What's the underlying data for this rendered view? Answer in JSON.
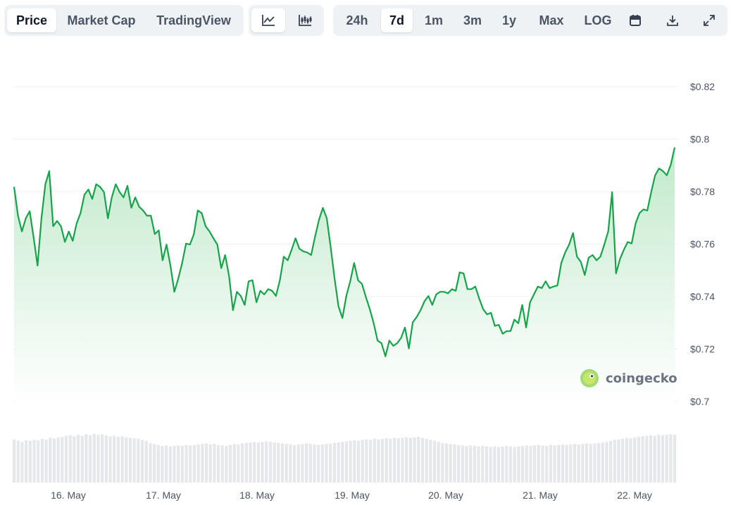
{
  "toolbar": {
    "metric_tabs": [
      "Price",
      "Market Cap",
      "TradingView"
    ],
    "active_metric": "Price",
    "chart_style_icons": [
      "line-chart-icon",
      "candlestick-icon"
    ],
    "ranges": [
      "24h",
      "7d",
      "1m",
      "3m",
      "1y",
      "Max",
      "LOG"
    ],
    "active_range": "7d",
    "action_icons": [
      "calendar-icon",
      "download-icon",
      "expand-icon"
    ]
  },
  "watermark": "coingecko",
  "colors": {
    "line": "#16a34a",
    "area_top": "#bde8c8",
    "volume": "#e5e7eb",
    "grid": "#eef0f3",
    "active_tab_bg": "#ffffff",
    "toolbar_bg": "#eff2f5"
  },
  "chart_data": {
    "type": "area",
    "ylim": [
      0.7,
      0.82
    ],
    "y_ticks": [
      "$0.82",
      "$0.8",
      "$0.78",
      "$0.76",
      "$0.74",
      "$0.72",
      "$0.7"
    ],
    "x_ticks": [
      "16. May",
      "17. May",
      "18. May",
      "19. May",
      "20. May",
      "21. May",
      "22. May"
    ],
    "series": [
      {
        "values": [
          0.7818,
          0.7708,
          0.7648,
          0.7698,
          0.7725,
          0.7625,
          0.7518,
          0.7698,
          0.7828,
          0.7878,
          0.7668,
          0.7688,
          0.7668,
          0.7608,
          0.7648,
          0.7612,
          0.7678,
          0.7718,
          0.7788,
          0.7808,
          0.7772,
          0.7828,
          0.7818,
          0.7798,
          0.7698,
          0.7778,
          0.7828,
          0.7798,
          0.7778,
          0.7822,
          0.7738,
          0.7778,
          0.7742,
          0.7728,
          0.7708,
          0.7708,
          0.7638,
          0.7652,
          0.7538,
          0.7598,
          0.7518,
          0.7418,
          0.7468,
          0.7528,
          0.7602,
          0.7598,
          0.7638,
          0.7728,
          0.7718,
          0.7668,
          0.7648,
          0.7622,
          0.7598,
          0.7508,
          0.7558,
          0.7478,
          0.7348,
          0.7418,
          0.7402,
          0.7368,
          0.7458,
          0.7462,
          0.7378,
          0.7422,
          0.7408,
          0.7428,
          0.7422,
          0.7402,
          0.7462,
          0.7552,
          0.7538,
          0.7578,
          0.7622,
          0.7582,
          0.7572,
          0.7568,
          0.7558,
          0.7628,
          0.7692,
          0.7738,
          0.7698,
          0.7588,
          0.7468,
          0.7362,
          0.7318,
          0.7402,
          0.7458,
          0.7528,
          0.7462,
          0.7448,
          0.7398,
          0.7352,
          0.7298,
          0.7232,
          0.7222,
          0.7172,
          0.7232,
          0.7212,
          0.7222,
          0.7242,
          0.7282,
          0.7202,
          0.7302,
          0.7322,
          0.7348,
          0.7382,
          0.7402,
          0.7368,
          0.7408,
          0.7418,
          0.7418,
          0.7412,
          0.7428,
          0.7422,
          0.7492,
          0.7488,
          0.7428,
          0.7428,
          0.7438,
          0.7392,
          0.7352,
          0.7332,
          0.7338,
          0.7288,
          0.7292,
          0.7258,
          0.7268,
          0.7268,
          0.7312,
          0.7298,
          0.7368,
          0.7282,
          0.7378,
          0.7408,
          0.7438,
          0.7432,
          0.7458,
          0.7432,
          0.7438,
          0.7442,
          0.7528,
          0.7568,
          0.7598,
          0.7642,
          0.7552,
          0.7532,
          0.7482,
          0.7548,
          0.7558,
          0.7538,
          0.7552,
          0.7598,
          0.7648,
          0.7798,
          0.7488,
          0.7542,
          0.7578,
          0.7608,
          0.7602,
          0.7678,
          0.7718,
          0.7732,
          0.7728,
          0.7798,
          0.7862,
          0.7888,
          0.7878,
          0.7862,
          0.7902,
          0.7968
        ]
      }
    ],
    "volume_relative": [
      0.85,
      0.82,
      0.8,
      0.83,
      0.82,
      0.84,
      0.83,
      0.86,
      0.84,
      0.88,
      0.87,
      0.89,
      0.9,
      0.92,
      0.93,
      0.91,
      0.94,
      0.92,
      0.95,
      0.93,
      0.96,
      0.94,
      0.95,
      0.93,
      0.91,
      0.92,
      0.9,
      0.91,
      0.89,
      0.88,
      0.87,
      0.86,
      0.84,
      0.82,
      0.78,
      0.76,
      0.74,
      0.72,
      0.73,
      0.71,
      0.72,
      0.73,
      0.72,
      0.74,
      0.73,
      0.74,
      0.75,
      0.76,
      0.77,
      0.75,
      0.76,
      0.74,
      0.73,
      0.72,
      0.74,
      0.76,
      0.75,
      0.77,
      0.78,
      0.79,
      0.8,
      0.79,
      0.8,
      0.81,
      0.8,
      0.79,
      0.78,
      0.77,
      0.76,
      0.75,
      0.74,
      0.75,
      0.76,
      0.77,
      0.76,
      0.75,
      0.74,
      0.75,
      0.76,
      0.77,
      0.78,
      0.79,
      0.8,
      0.81,
      0.82,
      0.83,
      0.82,
      0.84,
      0.85,
      0.84,
      0.86,
      0.85,
      0.86,
      0.87,
      0.86,
      0.88,
      0.87,
      0.88,
      0.89,
      0.88,
      0.89,
      0.9,
      0.88,
      0.86,
      0.84,
      0.82,
      0.8,
      0.78,
      0.77,
      0.76,
      0.75,
      0.74,
      0.73,
      0.72,
      0.73,
      0.72,
      0.71,
      0.72,
      0.71,
      0.7,
      0.71,
      0.7,
      0.71,
      0.72,
      0.71,
      0.7,
      0.71,
      0.72,
      0.73,
      0.72,
      0.73,
      0.74,
      0.73,
      0.72,
      0.74,
      0.73,
      0.74,
      0.75,
      0.74,
      0.75,
      0.76,
      0.75,
      0.76,
      0.77,
      0.76,
      0.77,
      0.78,
      0.79,
      0.8,
      0.82,
      0.84,
      0.85,
      0.86,
      0.88,
      0.87,
      0.89,
      0.9,
      0.91,
      0.92,
      0.93,
      0.92,
      0.94,
      0.93,
      0.94,
      0.95,
      0.94
    ]
  }
}
